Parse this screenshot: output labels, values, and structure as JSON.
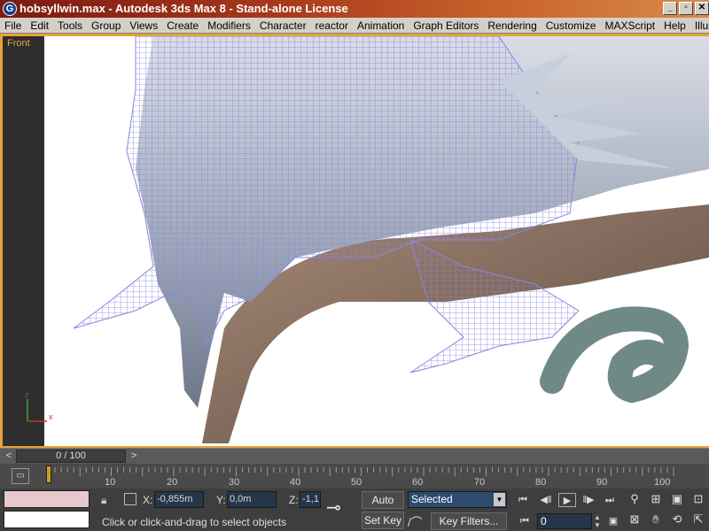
{
  "window": {
    "icon": "3ds-max-logo-icon",
    "title": "hobsyllwin.max - Autodesk 3ds Max 8  - Stand-alone License",
    "minimize": "_",
    "maximize": "▫",
    "close": "✕"
  },
  "menu": [
    "File",
    "Edit",
    "Tools",
    "Group",
    "Views",
    "Create",
    "Modifiers",
    "Character",
    "reactor",
    "Animation",
    "Graph Editors",
    "Rendering",
    "Customize",
    "MAXScript",
    "Help",
    "Illustrate!"
  ],
  "viewport": {
    "label": "Front",
    "axis_x": "x",
    "axis_y": "y",
    "axis_z": "z"
  },
  "time_slider": {
    "position": "0 / 100",
    "prev": "<",
    "next": ">"
  },
  "track_ticks": [
    "10",
    "20",
    "30",
    "40",
    "50",
    "60",
    "70",
    "80",
    "90",
    "100"
  ],
  "status": {
    "x_label": "X:",
    "x_value": "-0,855m",
    "y_label": "Y:",
    "y_value": "0,0m",
    "z_label": "Z:",
    "z_value": "-1,1",
    "prompt": "Click or click-and-drag to select objects",
    "auto_key": "Auto Key",
    "set_key": "Set Key",
    "selected": "Selected",
    "key_filters": "Key Filters...",
    "frame": "0"
  },
  "colors": {
    "title_gradient_start": "#7a1a12",
    "viewport_border": "#e8a23a",
    "wireframe": "#8a86e0"
  }
}
